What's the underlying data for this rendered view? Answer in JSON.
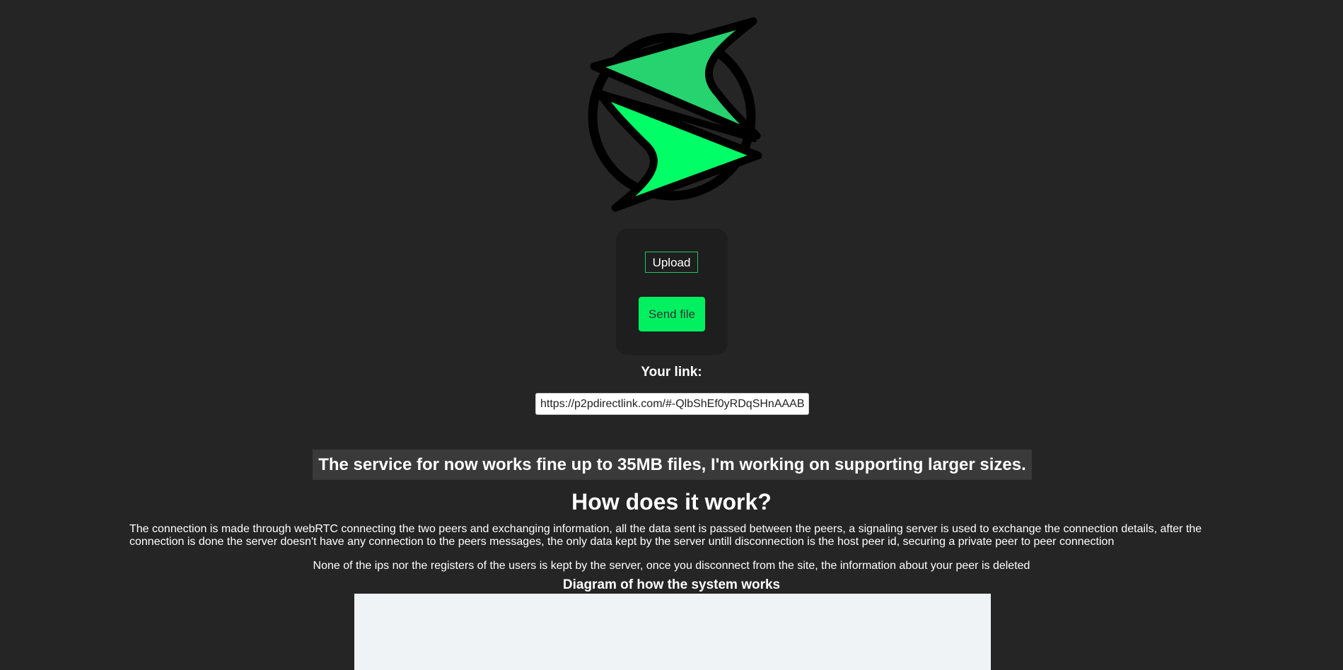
{
  "app": {
    "logo": "p2pdirectlink-lightning-logo",
    "colors": {
      "accent": "#00f060",
      "accent_dark": "#22c55e",
      "background": "#252525"
    }
  },
  "upload_panel": {
    "upload_label": "Upload",
    "send_label": "Send file"
  },
  "link": {
    "label": "Your link:",
    "value": "https://p2pdirectlink.com/#-QlbShEf0yRDqSHnAAAB"
  },
  "notice": "The service for now works fine up to 35MB files, I'm working on supporting larger sizes.",
  "how": {
    "title": "How does it work?",
    "description": "The connection is made through webRTC connecting the two peers and exchanging information, all the data sent is passed between the peers, a signaling server is used to exchange the connection details, after the connection is done the server doesn't have any connection to the peers messages, the only data kept by the server untill disconnection is the host peer id, securing a private peer to peer connection",
    "privacy": "None of the ips nor the registers of the users is kept by the server, once you disconnect from the site, the information about your peer is deleted",
    "diagram_title": "Diagram of how the system works"
  }
}
